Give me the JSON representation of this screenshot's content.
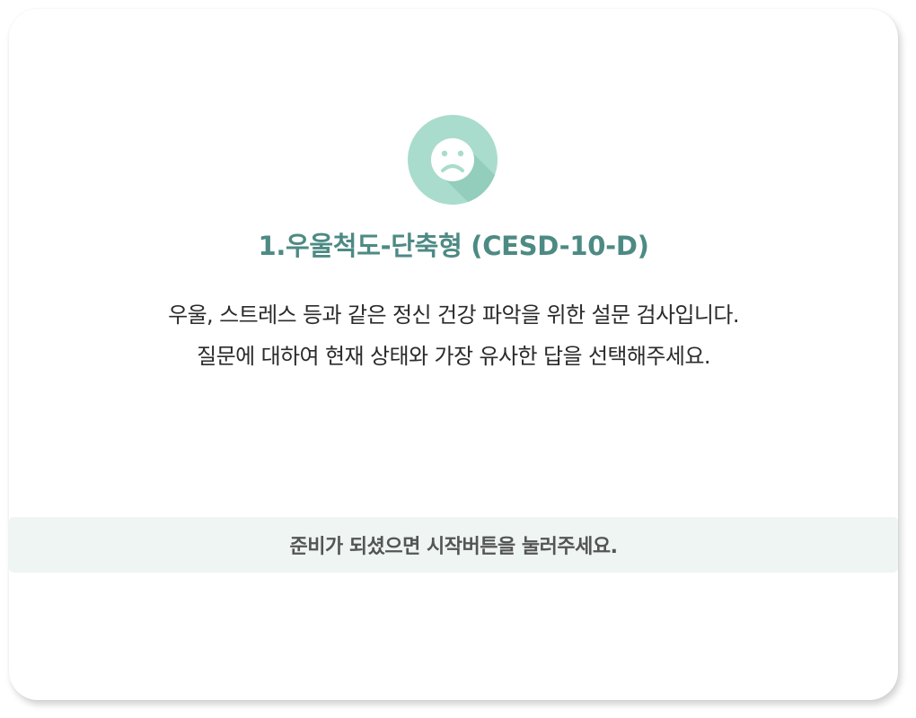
{
  "survey": {
    "icon": "sad-face-icon",
    "title": "1.우울척도-단축형 (CESD-10-D)",
    "description_line1": "우울, 스트레스 등과 같은 정신 건강 파악을 위한 설문 검사입니다.",
    "description_line2": "질문에 대하여 현재 상태와 가장 유사한 답을 선택해주세요."
  },
  "notice": {
    "text": "준비가 되셨으면 시작버튼을 눌러주세요."
  },
  "colors": {
    "accent": "#4d8a84",
    "icon_circle": "#a9dccd",
    "icon_shadow": "#93cdbc",
    "notice_bg": "#eef5f3"
  }
}
